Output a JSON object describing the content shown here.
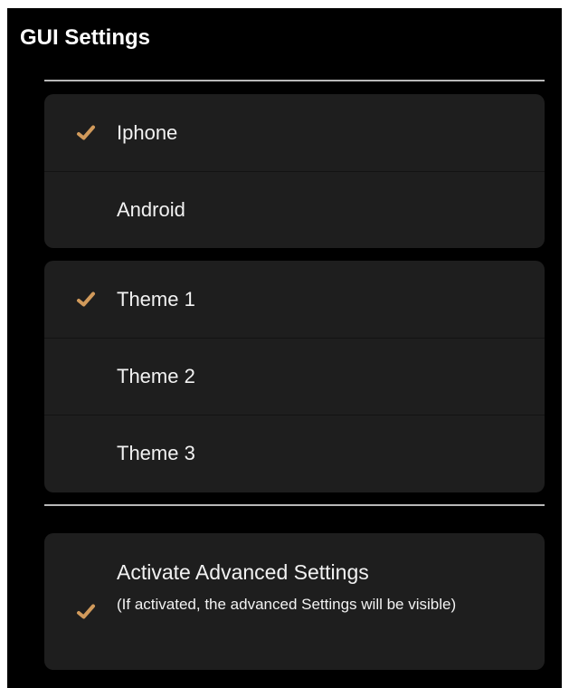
{
  "title": "GUI Settings",
  "colors": {
    "background": "#000000",
    "group_background": "#1e1e1e",
    "divider": "#b8b8b8",
    "checkmark": "#d19a5b",
    "text": "#f2f2f2"
  },
  "device_group": {
    "items": [
      {
        "label": "Iphone",
        "checked": true,
        "icon": "checkmark-icon"
      },
      {
        "label": "Android",
        "checked": false
      }
    ]
  },
  "theme_group": {
    "items": [
      {
        "label": "Theme 1",
        "checked": true,
        "icon": "checkmark-icon"
      },
      {
        "label": "Theme 2",
        "checked": false
      },
      {
        "label": "Theme 3",
        "checked": false
      }
    ]
  },
  "advanced": {
    "label": "Activate Advanced Settings",
    "description": "(If activated, the advanced Settings will be visible)",
    "checked": true,
    "icon": "checkmark-icon"
  }
}
